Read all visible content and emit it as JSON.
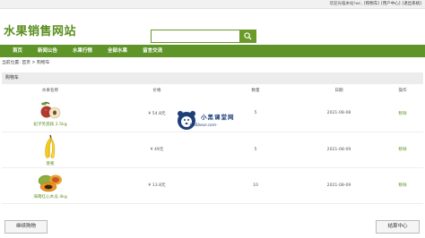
{
  "topbar": {
    "welcome": "欢迎光临本站!wc,",
    "cart_link": "[购物车]",
    "user_center_link": "[用户中心]",
    "logout_link": "[退出系统]"
  },
  "header": {
    "logo": "水果销售网站",
    "search_placeholder": ""
  },
  "nav": {
    "items": [
      "首页",
      "新闻公告",
      "水果行情",
      "全部水果",
      "留言交流"
    ]
  },
  "breadcrumb": {
    "text": "当前位置: 首页 > 购物车"
  },
  "cart": {
    "title": "购物车",
    "columns": [
      "水果名称",
      "价格",
      "数量",
      "日期",
      "操作"
    ],
    "rows": [
      {
        "name": "妃子笑荔枝 2.5kg",
        "price": "¥ 54.8元",
        "qty": "5",
        "date": "2021-08-08",
        "action": "移除",
        "icon": "lychee-icon"
      },
      {
        "name": "香蕉",
        "price": "¥ 49元",
        "qty": "5",
        "date": "2021-08-09",
        "action": "移除",
        "icon": "banana-icon"
      },
      {
        "name": "海南红心木瓜 4kg",
        "price": "¥ 13.8元",
        "qty": "10",
        "date": "2021-08-09",
        "action": "移除",
        "icon": "papaya-icon"
      }
    ]
  },
  "footer": {
    "continue_label": "继续购物",
    "checkout_label": "结算中心"
  },
  "watermark": {
    "title": "小黑课堂网",
    "url": "-666bear.com-"
  },
  "colors": {
    "brand_green": "#5f9428",
    "link_green": "#5a8f1f"
  }
}
